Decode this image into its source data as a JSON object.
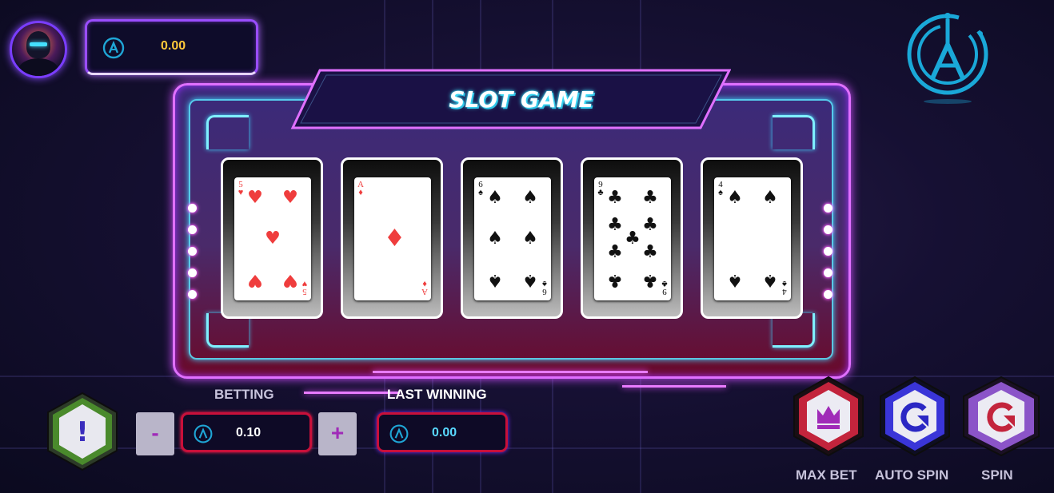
{
  "player": {
    "avatar": "player-avatar"
  },
  "balance": {
    "icon": "coin-icon",
    "value": "0.00",
    "color": "#ffc93a"
  },
  "logo": {
    "icon": "brand-logo-icon"
  },
  "game": {
    "title": "SLOT GAME"
  },
  "reels": [
    {
      "rank": "5",
      "suit": "♥",
      "color": "red"
    },
    {
      "rank": "A",
      "suit": "♦",
      "color": "red"
    },
    {
      "rank": "6",
      "suit": "♠",
      "color": "black"
    },
    {
      "rank": "9",
      "suit": "♣",
      "color": "black"
    },
    {
      "rank": "4",
      "suit": "♠",
      "color": "black"
    }
  ],
  "betting": {
    "label": "BETTING",
    "minus": "-",
    "plus": "+",
    "value": "0.10"
  },
  "last_winning": {
    "label": "LAST WINNING",
    "value": "0.00",
    "color": "#59d9ff"
  },
  "info_button": {
    "symbol": "!"
  },
  "actions": [
    {
      "label": "MAX BET",
      "icon": "crown-icon"
    },
    {
      "label": "AUTO SPIN",
      "icon": "auto-spin-icon"
    },
    {
      "label": "SPIN",
      "icon": "spin-icon"
    }
  ],
  "colors": {
    "neon_pink": "#e070ff",
    "neon_cyan": "#40d8ff",
    "gold": "#ffc93a"
  }
}
